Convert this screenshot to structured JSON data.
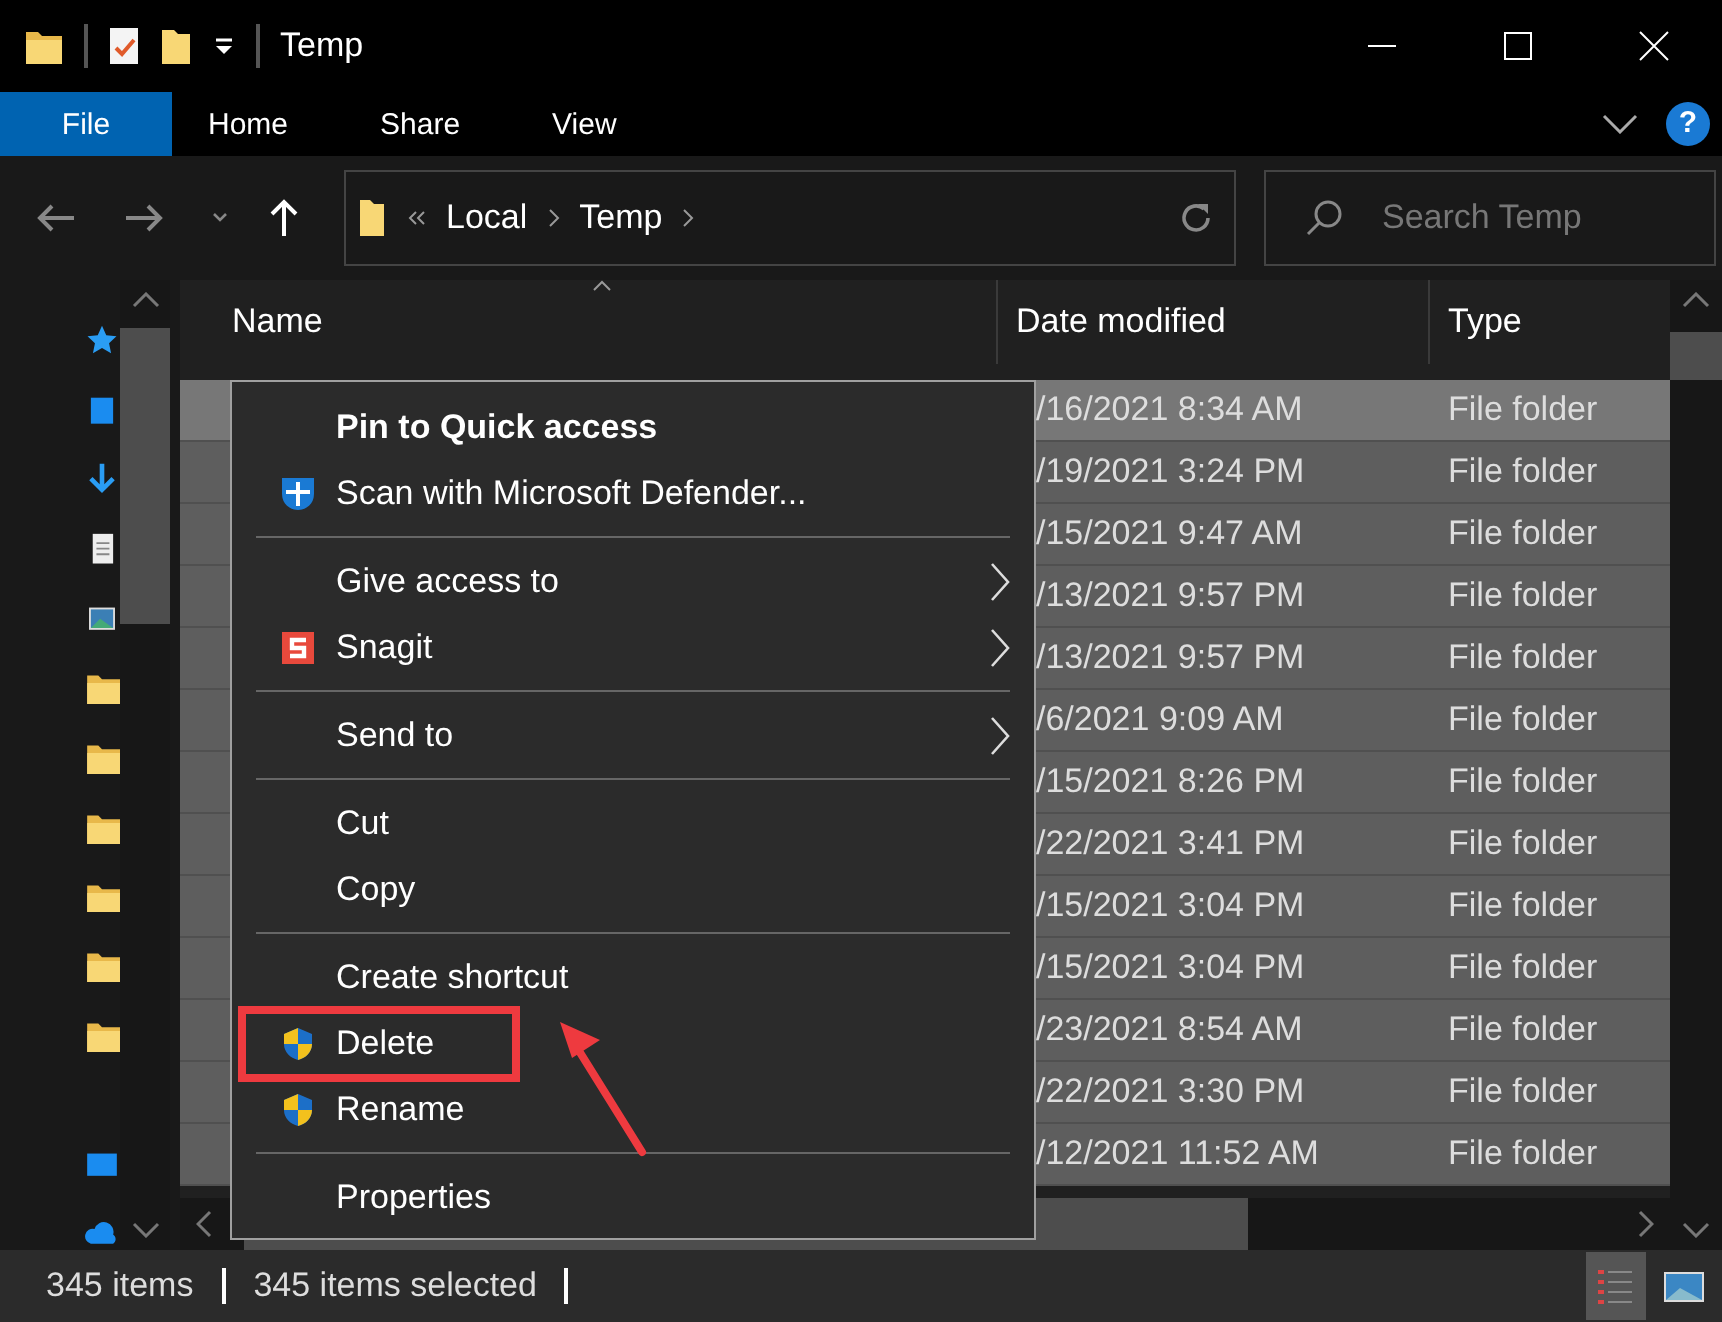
{
  "window": {
    "title": "Temp"
  },
  "ribbon_tabs": [
    {
      "label": "File",
      "selected": true
    },
    {
      "label": "Home",
      "selected": false
    },
    {
      "label": "Share",
      "selected": false
    },
    {
      "label": "View",
      "selected": false
    }
  ],
  "help_button": "?",
  "address_bar": {
    "path": [
      "Local",
      "Temp"
    ]
  },
  "search": {
    "placeholder": "Search Temp"
  },
  "file_list": {
    "columns": [
      {
        "label": "Name",
        "sorted": true
      },
      {
        "label": "Date modified",
        "sorted": false
      },
      {
        "label": "Type",
        "sorted": false
      }
    ],
    "rows": [
      {
        "date": "/16/2021 8:34 AM",
        "type": "File folder",
        "selected": true,
        "focused": true
      },
      {
        "date": "/19/2021 3:24 PM",
        "type": "File folder",
        "selected": true,
        "focused": false
      },
      {
        "date": "/15/2021 9:47 AM",
        "type": "File folder",
        "selected": true,
        "focused": false
      },
      {
        "date": "/13/2021 9:57 PM",
        "type": "File folder",
        "selected": true,
        "focused": false
      },
      {
        "date": "/13/2021 9:57 PM",
        "type": "File folder",
        "selected": true,
        "focused": false
      },
      {
        "date": "/6/2021 9:09 AM",
        "type": "File folder",
        "selected": true,
        "focused": false
      },
      {
        "date": "/15/2021 8:26 PM",
        "type": "File folder",
        "selected": true,
        "focused": false
      },
      {
        "date": "/22/2021 3:41 PM",
        "type": "File folder",
        "selected": true,
        "focused": false
      },
      {
        "date": "/15/2021 3:04 PM",
        "type": "File folder",
        "selected": true,
        "focused": false
      },
      {
        "date": "/15/2021 3:04 PM",
        "type": "File folder",
        "selected": true,
        "focused": false
      },
      {
        "date": "/23/2021 8:54 AM",
        "type": "File folder",
        "selected": true,
        "focused": false
      },
      {
        "date": "/22/2021 3:30 PM",
        "type": "File folder",
        "selected": true,
        "focused": false
      },
      {
        "date": "/12/2021 11:52 AM",
        "type": "File folder",
        "selected": true,
        "focused": false
      }
    ]
  },
  "context_menu": {
    "items": [
      {
        "kind": "item",
        "label": "Pin to Quick access",
        "bold": true
      },
      {
        "kind": "defender_item",
        "label": "Scan with Microsoft Defender..."
      },
      {
        "kind": "separator"
      },
      {
        "kind": "item",
        "label": "Give access to",
        "submenu": true
      },
      {
        "kind": "snagit_item",
        "label": "Snagit",
        "submenu": true
      },
      {
        "kind": "separator"
      },
      {
        "kind": "item",
        "label": "Send to",
        "submenu": true
      },
      {
        "kind": "separator"
      },
      {
        "kind": "item",
        "label": "Cut"
      },
      {
        "kind": "item",
        "label": "Copy"
      },
      {
        "kind": "separator"
      },
      {
        "kind": "item",
        "label": "Create shortcut"
      },
      {
        "kind": "admin_item",
        "label": "Delete",
        "highlighted": true
      },
      {
        "kind": "admin_item",
        "label": "Rename"
      },
      {
        "kind": "separator"
      },
      {
        "kind": "item",
        "label": "Properties"
      }
    ]
  },
  "status_bar": {
    "item_count": "345 items",
    "selection": "345 items selected",
    "views": [
      {
        "kind": "details",
        "selected": true
      },
      {
        "kind": "large_icons",
        "selected": false
      }
    ]
  }
}
